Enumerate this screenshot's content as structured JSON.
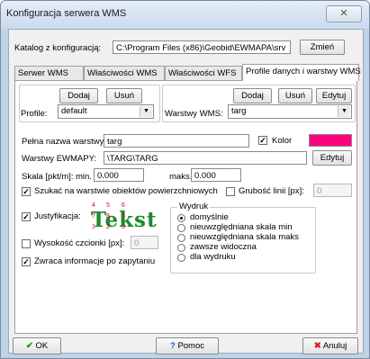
{
  "window": {
    "title": "Konfiguracja serwera WMS",
    "close_label": "✕"
  },
  "catalog": {
    "label": "Katalog z konfiguracją:",
    "value": "C:\\Program Files (x86)\\Geobid\\EWMAPA\\srv",
    "change_label": "Zmień"
  },
  "tabs": [
    {
      "label": "Serwer WMS"
    },
    {
      "label": "Właściwości WMS"
    },
    {
      "label": "Właściwości WFS"
    },
    {
      "label": "Profile danych i warstwy WMS"
    }
  ],
  "profiles": {
    "label": "Profile:",
    "add": "Dodaj",
    "remove": "Usuń",
    "selected": "default"
  },
  "layers": {
    "label": "Warstwy WMS:",
    "add": "Dodaj",
    "remove": "Usuń",
    "edit": "Edytuj",
    "selected": "targ"
  },
  "form": {
    "full_name_label": "Pełna nazwa warstwy:",
    "full_name_value": "targ",
    "color_label": "Kolor",
    "color_hex": "#ff0080",
    "ewmapa_label": "Warstwy EWMAPY:",
    "ewmapa_value": "\\TARG\\TARG",
    "ewmapa_edit": "Edytuj",
    "scale_label": "Skala [pkt/m]:",
    "min_label": "min.",
    "min_value": "0.000",
    "max_label": "maks.",
    "max_value": "0.000",
    "search_label": "Szukać na warstwie obiektów powierzchniowych",
    "line_width_label": "Grubość linii [px]:",
    "line_width_value": "0",
    "justify_label": "Justyfikacja:",
    "justify_sample": "Tekst",
    "justify_digits": [
      "4",
      "5",
      "6",
      "7",
      "8",
      "9",
      "1",
      "2",
      "3"
    ],
    "font_height_label": "Wysokość czcionki [px]:",
    "font_height_value": "0",
    "returns_label": "Zwraca informacje po zapytaniu"
  },
  "print": {
    "label": "Wydruk",
    "options": [
      {
        "label": "domyślnie",
        "selected": true
      },
      {
        "label": "nieuwzględniana skala min",
        "selected": false
      },
      {
        "label": "nieuwzględniana skala maks",
        "selected": false
      },
      {
        "label": "zawsze widoczna",
        "selected": false
      },
      {
        "label": "dla wydruku",
        "selected": false
      }
    ]
  },
  "footer": {
    "ok": "OK",
    "help": "Pomoc",
    "cancel": "Anuluj"
  },
  "colors": {
    "accent": "#ff0080",
    "ok_icon": "#2e8b1e",
    "cancel_icon": "#d42020",
    "help_icon": "#1f5fbf"
  }
}
